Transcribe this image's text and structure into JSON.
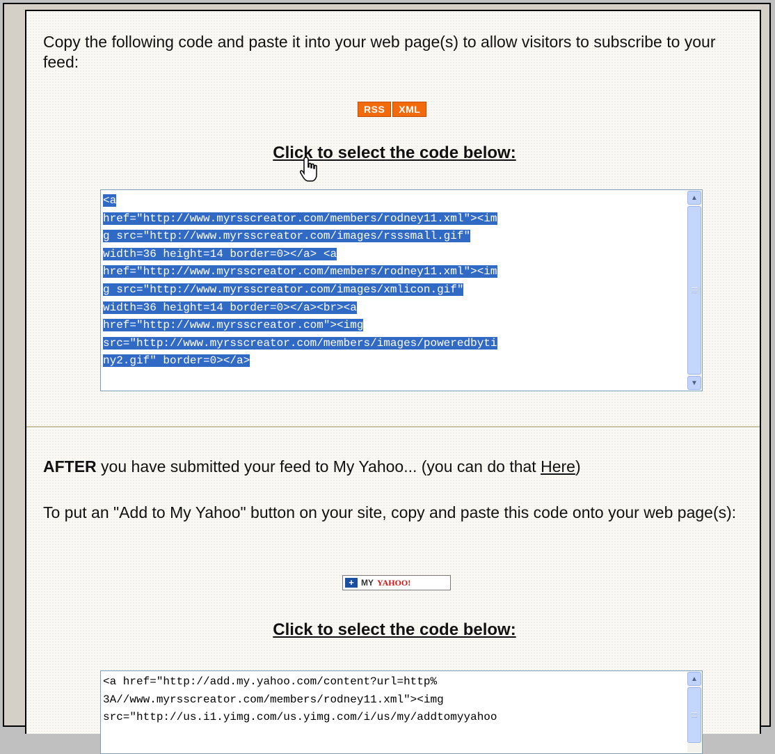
{
  "intro": {
    "text": "Copy the following code and paste it into your web page(s) to allow visitors to subscribe to your feed:"
  },
  "badges": {
    "rss": "RSS",
    "xml": "XML",
    "color": "#f26a0c"
  },
  "select_heading_1": "Click to select the code below:",
  "code_box_1": {
    "lines": [
      "<a",
      "href=\"http://www.myrsscreator.com/members/rodney11.xml\"><im",
      "g src=\"http://www.myrsscreator.com/images/rsssmall.gif\"",
      "width=36 height=14 border=0></a>  <a",
      "href=\"http://www.myrsscreator.com/members/rodney11.xml\"><im",
      "g src=\"http://www.myrsscreator.com/images/xmlicon.gif\"",
      "width=36 height=14 border=0></a><br><a",
      "href=\"http://www.myrsscreator.com\"><img",
      "src=\"http://www.myrsscreator.com/members/images/poweredbyti",
      "ny2.gif\" border=0></a>"
    ],
    "selected": true,
    "selection_color": "#316ac5"
  },
  "after": {
    "bold": "AFTER",
    "text": " you have submitted your feed to My Yahoo... (you can do that ",
    "link": "Here",
    "end": ")"
  },
  "yahoo_instructions": "To put an \"Add to My Yahoo\" button on your site, copy and paste this code onto your web page(s):",
  "yahoo_button": {
    "plus": "+",
    "my": "MY",
    "brand": "YAHOO!"
  },
  "select_heading_2": "Click to select the code below:",
  "code_box_2": {
    "lines": [
      "<a href=\"http://add.my.yahoo.com/content?url=http%",
      "3A//www.myrsscreator.com/members/rodney11.xml\"><img",
      "src=\"http://us.i1.yimg.com/us.yimg.com/i/us/my/addtomyyahoo"
    ]
  },
  "icons": {
    "cursor": "hand-pointer-icon",
    "scroll_up": "arrow-up-icon",
    "scroll_down": "arrow-down-icon"
  }
}
